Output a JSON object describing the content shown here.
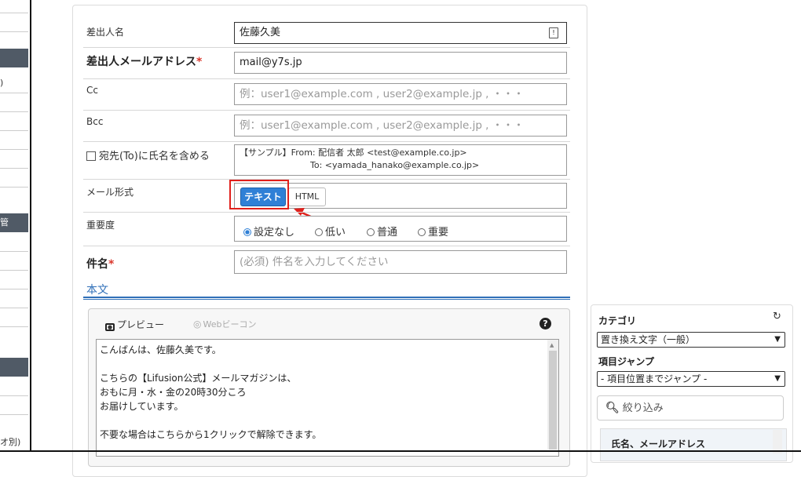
{
  "sidebar": {
    "text_1": ")",
    "text_2": "管",
    "text_3": "オ別)"
  },
  "form": {
    "sender_name": {
      "label": "差出人名",
      "value": "佐藤久美"
    },
    "sender_email": {
      "label": "差出人メールアドレス",
      "required_mark": "*",
      "value": "mail@y7s.jp"
    },
    "cc": {
      "label": "Cc",
      "placeholder": "例：user1@example.com , user2@example.jp , ・・・"
    },
    "bcc": {
      "label": "Bcc",
      "placeholder": "例：user1@example.com , user2@example.jp , ・・・"
    },
    "include_name": {
      "label": "宛先(To)に氏名を含める",
      "sample_line1": "【サンプル】From: 配信者 太郎 <test@example.co.jp>",
      "sample_line2": "To: <yamada_hanako@example.co.jp>"
    },
    "mail_format": {
      "label": "メール形式",
      "text_option": "テキスト",
      "html_option": "HTML"
    },
    "priority": {
      "label": "重要度",
      "options": [
        "設定なし",
        "低い",
        "普通",
        "重要"
      ],
      "selected": "設定なし"
    },
    "subject": {
      "label": "件名",
      "required_mark": "*",
      "placeholder": "(必須) 件名を入力してください"
    },
    "body": {
      "heading": "本文",
      "preview_tab": "プレビュー",
      "webbeacon_tab": "Webビーコン",
      "help_icon": "?",
      "lines": [
        "こんばんは、佐藤久美です。",
        "",
        "こちらの【Lifusion公式】メールマガジンは、",
        "おもに月・水・金の20時30分ころ",
        "お届けしています。",
        "",
        "不要な場合はこちらから1クリックで解除できます。"
      ]
    }
  },
  "right_panel": {
    "category_label": "カテゴリ",
    "category_value": "置き換え文字（一般）",
    "jump_label": "項目ジャンプ",
    "jump_value": "- 項目位置までジャンプ -",
    "filter_label": "絞り込み",
    "list_item": "氏名、メールアドレス"
  },
  "colors": {
    "accent": "#2f80d6",
    "highlight": "#e0201b",
    "required": "#d9362b",
    "heading_blue": "#2f6fb8"
  }
}
